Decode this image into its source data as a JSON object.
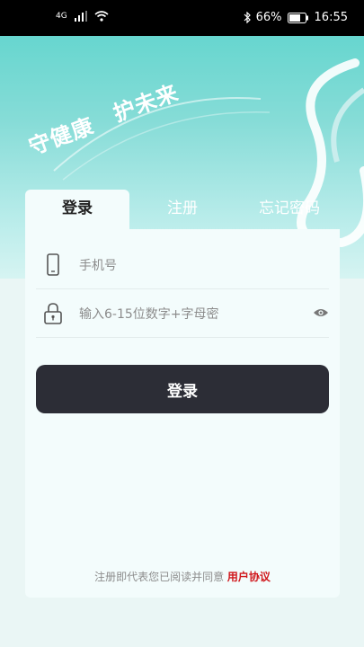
{
  "status_bar": {
    "network": "4G",
    "battery": "66%",
    "time": "16:55"
  },
  "banner": {
    "slogan_1": "守健康",
    "slogan_2": "护未来"
  },
  "tabs": {
    "login": "登录",
    "register": "注册",
    "forgot": "忘记密码"
  },
  "form": {
    "phone_placeholder": "手机号",
    "password_placeholder": "输入6-15位数字+字母密",
    "login_button": "登录"
  },
  "agreement": {
    "text": "注册即代表您已阅读并同意",
    "link": "用户协议"
  },
  "colors": {
    "accent": "#67d6cf",
    "button": "#2c2d36",
    "link": "#d0161b"
  }
}
